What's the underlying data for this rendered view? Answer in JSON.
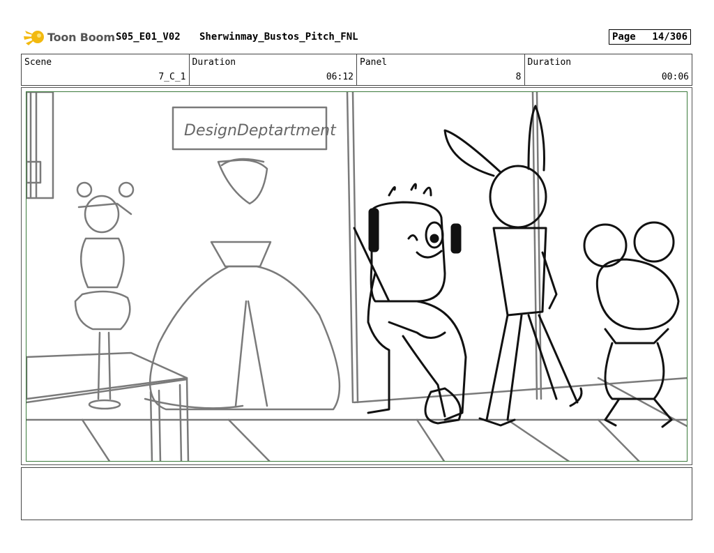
{
  "header": {
    "logo_text": "Toon Boom",
    "episode": "S05_E01_V02",
    "title": "Sherwinmay_Bustos_Pitch_FNL",
    "page_label": "Page",
    "page_number": "14/306"
  },
  "info": {
    "scene_label": "Scene",
    "scene_value": "7_C_1",
    "duration_label": "Duration",
    "duration_value": "06:12",
    "panel_label": "Panel",
    "panel_value": "8",
    "panel_duration_label": "Duration",
    "panel_duration_value": "00:06"
  },
  "panel": {
    "sign_text": "DesignDeptartment"
  },
  "notes": {
    "text": ""
  },
  "colors": {
    "frame_green": "#3a7a3a",
    "sketch_gray": "#7a7a7a",
    "sketch_black": "#111111",
    "logo_yellow": "#f2b90f"
  }
}
